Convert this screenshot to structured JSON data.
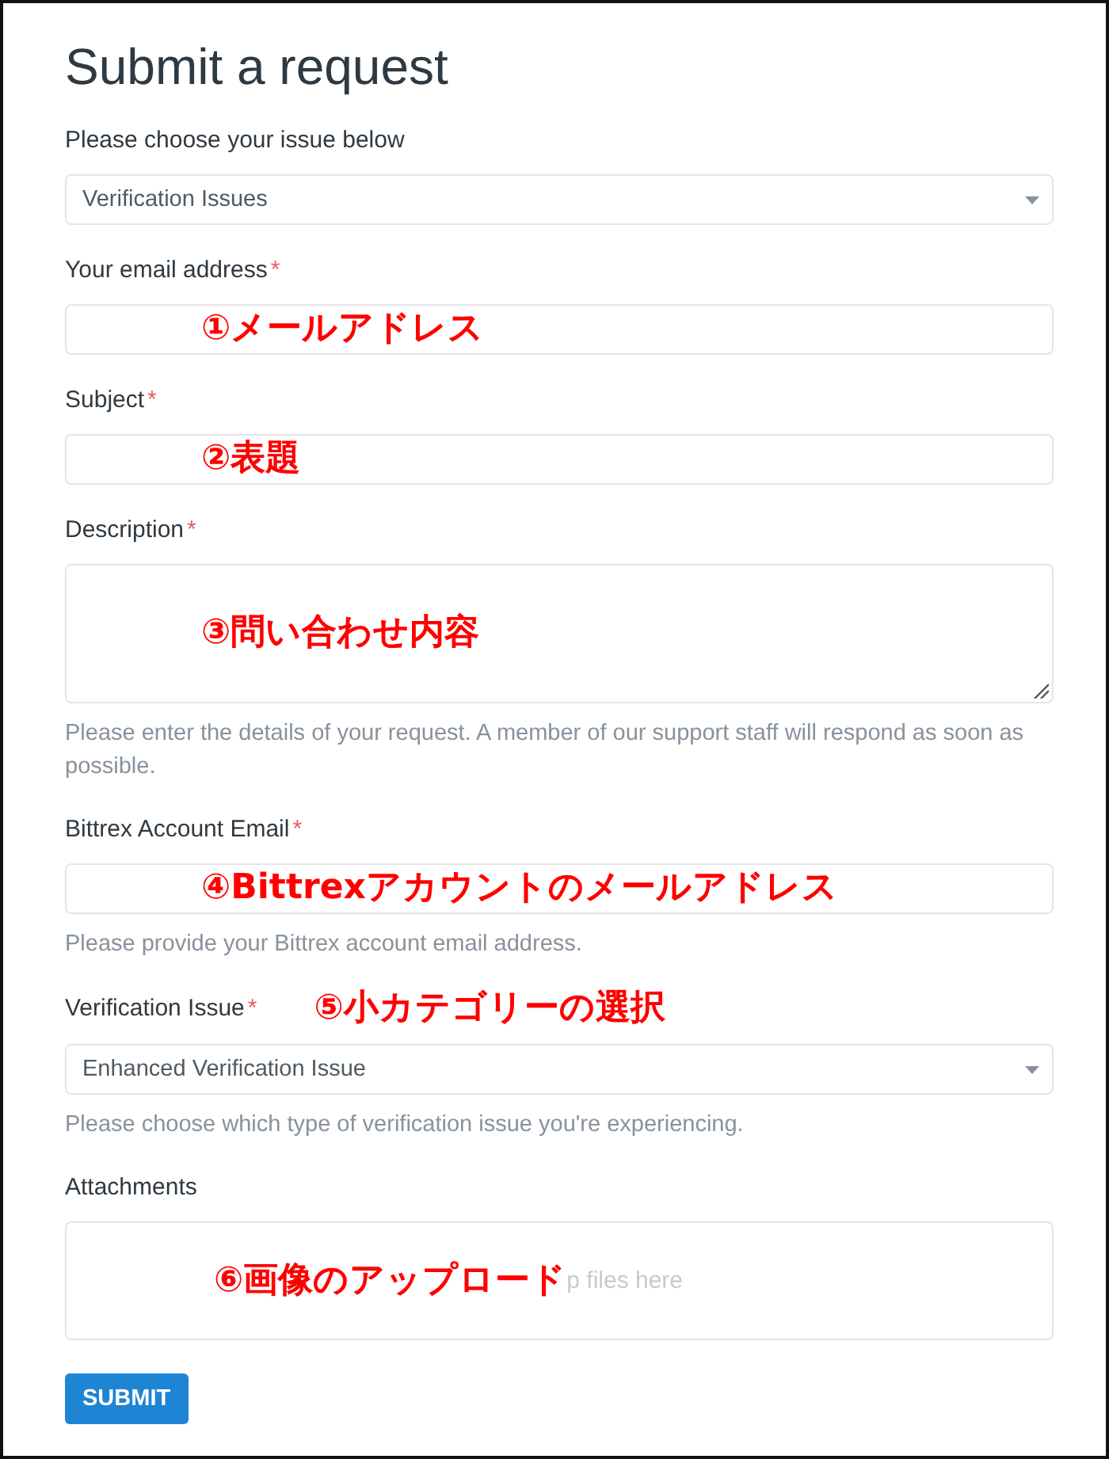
{
  "title": "Submit a request",
  "fields": [
    {
      "kind": "select",
      "label": "Please choose your issue below",
      "value": "Verification Issues"
    },
    {
      "kind": "input",
      "label": "Your email address",
      "required_mark": "*",
      "annotation": {
        "text": "①メールアドレス",
        "kind": "overlay"
      }
    },
    {
      "kind": "input",
      "label": "Subject",
      "required_mark": "*",
      "annotation": {
        "text": "②表題",
        "kind": "overlay"
      }
    },
    {
      "kind": "textarea",
      "label": "Description",
      "required_mark": "*",
      "annotation": {
        "text": "③問い合わせ内容",
        "kind": "overlay"
      },
      "hint": "Please enter the details of your request. A member of our support staff will respond as soon as possible."
    },
    {
      "kind": "input",
      "label": "Bittrex Account Email",
      "required_mark": "*",
      "annotation": {
        "text": "④Bittrexアカウントのメールアドレス",
        "kind": "overlay"
      },
      "hint": "Please provide your Bittrex account email address."
    },
    {
      "kind": "select",
      "label": "Verification Issue",
      "required_mark": "*",
      "annotation": {
        "text": "⑤小カテゴリーの選択",
        "kind": "beside"
      },
      "value": "Enhanced Verification Issue",
      "hint": "Please choose which type of verification issue you're experiencing."
    },
    {
      "kind": "dropzone",
      "label": "Attachments",
      "annotation": {
        "text": "⑥画像のアップロード",
        "kind": "overlay"
      },
      "text": "p files here"
    }
  ],
  "submit": {
    "label": "SUBMIT"
  }
}
